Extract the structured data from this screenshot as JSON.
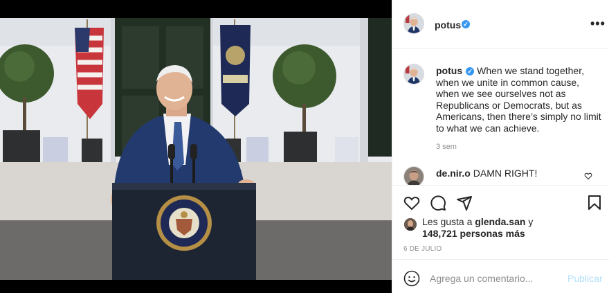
{
  "post": {
    "username": "potus",
    "verified": true,
    "more_icon": "more-horizontal-icon",
    "photo_description": "President at podium with flags",
    "caption": {
      "username": "potus",
      "text": "When we stand together, when we unite in common cause, when we see ourselves not as Republicans or Democrats, but as Americans, then there’s simply no limit to what we can achieve.",
      "time_ago": "3 sem"
    },
    "comments": [
      {
        "username": "de.nir.o",
        "text": "DAMN RIGHT!"
      }
    ],
    "actions": {
      "like_icon": "heart-icon",
      "comment_icon": "comment-icon",
      "share_icon": "send-icon",
      "save_icon": "bookmark-icon"
    },
    "likes": {
      "prefix": "Les gusta a",
      "first_user": "glenda.san",
      "joiner": "y",
      "others": "148,721 personas más"
    },
    "date": "6 DE JULIO",
    "add_comment": {
      "placeholder": "Agrega un comentario...",
      "post_label": "Publicar",
      "emoji_icon": "smiley-icon"
    }
  },
  "colors": {
    "verified_blue": "#3897f0",
    "post_button_disabled": "#b2dffc",
    "secondary_text": "#8e8e8e",
    "primary_text": "#262626"
  }
}
